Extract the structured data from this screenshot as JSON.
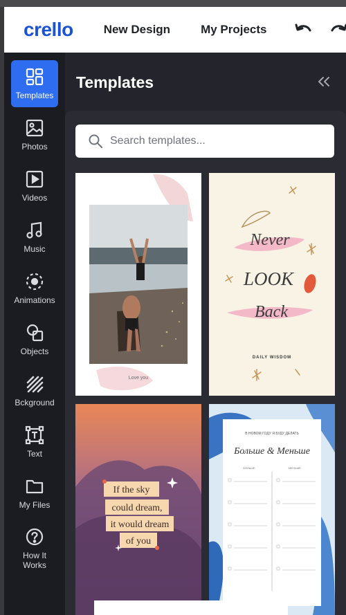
{
  "topbar": {
    "logo": "crello",
    "nav": [
      "New Design",
      "My Projects"
    ]
  },
  "sidebar": {
    "items": [
      {
        "label": "Templates",
        "icon": "templates-icon",
        "active": true
      },
      {
        "label": "Photos",
        "icon": "photos-icon"
      },
      {
        "label": "Videos",
        "icon": "videos-icon"
      },
      {
        "label": "Music",
        "icon": "music-icon"
      },
      {
        "label": "Animations",
        "icon": "animations-icon"
      },
      {
        "label": "Objects",
        "icon": "objects-icon"
      },
      {
        "label": "Bckground",
        "icon": "background-icon"
      },
      {
        "label": "Text",
        "icon": "text-icon"
      },
      {
        "label": "My Files",
        "icon": "folder-icon"
      },
      {
        "label": "How It Works",
        "icon": "help-icon"
      }
    ]
  },
  "panel": {
    "title": "Templates",
    "search_placeholder": "Search templates...",
    "templates": [
      {
        "caption": "Love you"
      },
      {
        "lines": [
          "Never",
          "LOOK",
          "Back"
        ],
        "caption": "DAILY WISDOM"
      },
      {
        "lines": [
          "If the sky",
          "could dream,",
          "it would dream",
          "of you"
        ]
      },
      {
        "header": "В НОВОМ ГОДУ Я БУДУ ДЕЛАТЬ",
        "title": "Больше & Меньше",
        "col_a": "БОЛЬШЕ",
        "col_b": "МЕНЬШЕ"
      }
    ]
  },
  "colors": {
    "accent": "#2e6cf0",
    "logo": "#1a54d4",
    "sidebar_bg": "#1b1c22"
  }
}
